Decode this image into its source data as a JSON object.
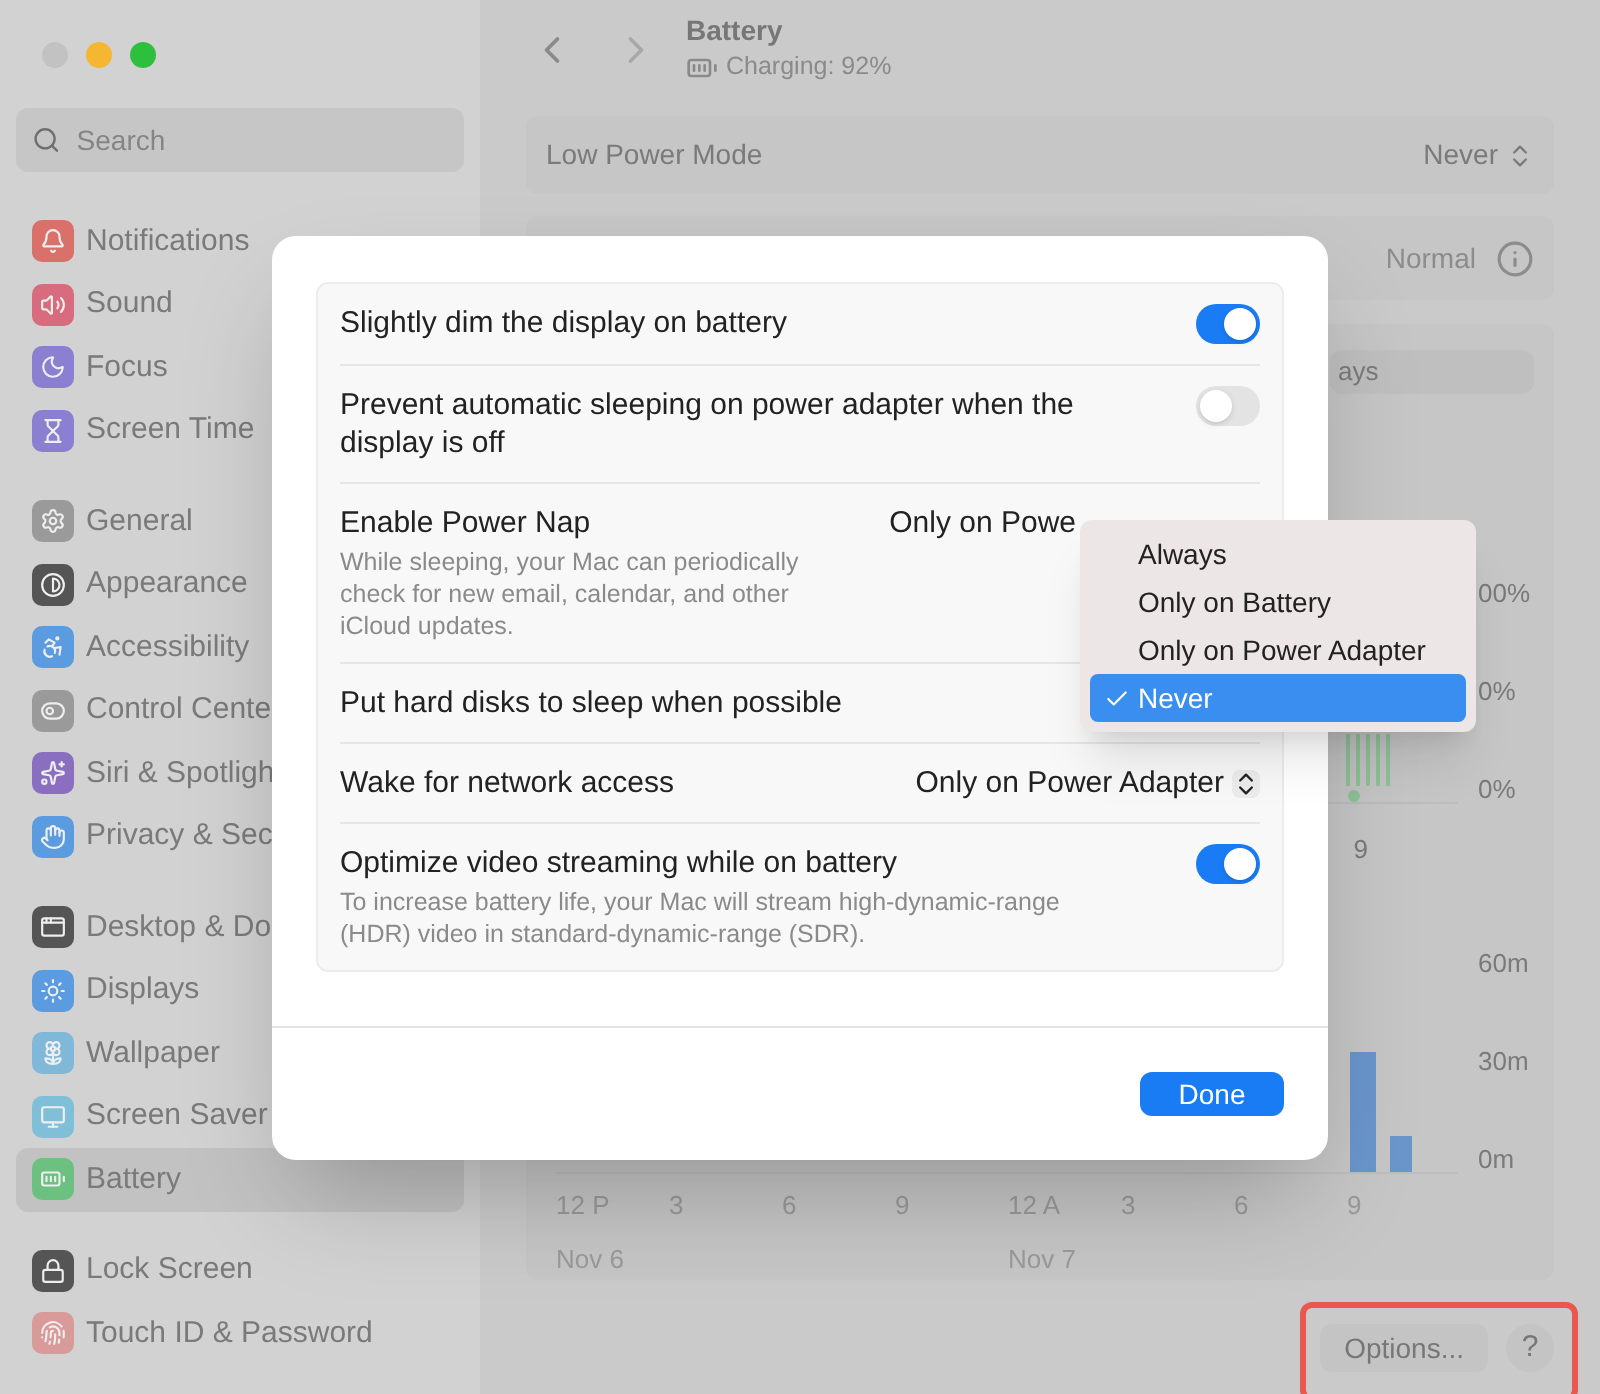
{
  "sidebar": {
    "search": {
      "placeholder": "Search"
    },
    "groups": [
      [
        {
          "label": "Notifications",
          "selected": false
        },
        {
          "label": "Sound",
          "selected": false
        },
        {
          "label": "Focus",
          "selected": false
        },
        {
          "label": "Screen Time",
          "selected": false
        }
      ],
      [
        {
          "label": "General",
          "selected": false
        },
        {
          "label": "Appearance",
          "selected": false
        },
        {
          "label": "Accessibility",
          "selected": false
        },
        {
          "label": "Control Cente",
          "selected": false
        },
        {
          "label": "Siri & Spotligh",
          "selected": false
        },
        {
          "label": "Privacy & Sec",
          "selected": false
        }
      ],
      [
        {
          "label": "Desktop & Do",
          "selected": false
        },
        {
          "label": "Displays",
          "selected": false
        },
        {
          "label": "Wallpaper",
          "selected": false
        },
        {
          "label": "Screen Saver",
          "selected": false
        },
        {
          "label": "Battery",
          "selected": true
        }
      ],
      [
        {
          "label": "Lock Screen",
          "selected": false
        },
        {
          "label": "Touch ID & Password",
          "selected": false
        }
      ]
    ]
  },
  "header": {
    "title": "Battery",
    "status": "Charging: 92%"
  },
  "low_power_mode": {
    "label": "Low Power Mode",
    "value": "Never"
  },
  "row_2": {
    "value": "Normal"
  },
  "usage_panel": {
    "segment": "ays",
    "battery_axis": [
      "00%",
      "0%",
      "0%"
    ],
    "battery_x_label": "9",
    "time_axis": [
      "60m",
      "30m",
      "0m"
    ],
    "x_labels": [
      "12 P",
      "3",
      "6",
      "9",
      "12 A",
      "3",
      "6",
      "9"
    ],
    "dates": [
      "Nov 6",
      "Nov 7"
    ]
  },
  "footer": {
    "highlighted": true,
    "buttons": [
      {
        "kind": "text",
        "label": "Options..."
      },
      {
        "kind": "help",
        "label": "?"
      }
    ]
  },
  "dialog": {
    "rows": [
      {
        "kind": "toggle",
        "label": "Slightly dim the display on battery",
        "on": true
      },
      {
        "kind": "toggle",
        "label": "Prevent automatic sleeping on power adapter when the display is off",
        "on": false
      },
      {
        "kind": "popup",
        "label": "Enable Power Nap",
        "description": "While sleeping, your Mac can periodically check for new email, calendar, and other iCloud updates.",
        "value": "Only on Powe"
      },
      {
        "kind": "plain",
        "label": "Put hard disks to sleep when possible"
      },
      {
        "kind": "popup",
        "label": "Wake for network access",
        "value": "Only on Power Adapter"
      },
      {
        "kind": "toggle",
        "label": "Optimize video streaming while on battery",
        "description": "To increase battery life, your Mac will stream high-dynamic-range (HDR) video in standard-dynamic-range (SDR).",
        "on": true
      }
    ],
    "button": "Done"
  },
  "menu": {
    "items": [
      {
        "label": "Always",
        "selected": false
      },
      {
        "label": "Only on Battery",
        "selected": false
      },
      {
        "label": "Only on Power Adapter",
        "selected": false
      },
      {
        "label": "Never",
        "selected": true
      }
    ]
  }
}
